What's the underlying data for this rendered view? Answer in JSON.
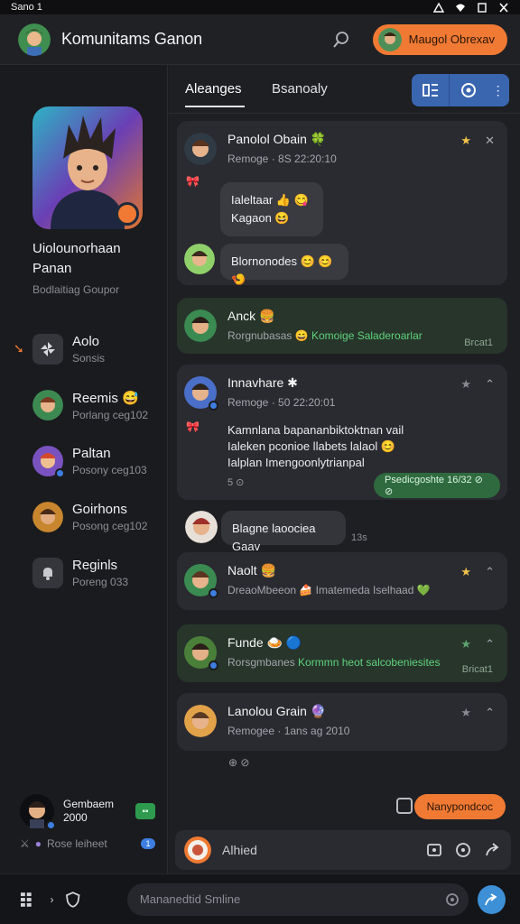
{
  "status_bar": {
    "time": "Sano 1"
  },
  "header": {
    "title": "Komunitams Ganon",
    "profile_label": "Maugol Obrexav"
  },
  "sidebar": {
    "hero_name": "Uiolounorhaan Panan",
    "hero_sub": "Bodlaitiag Goupor",
    "items": [
      {
        "title": "Aolo",
        "sub": "Sonsis",
        "icon": "pinwheel-icon",
        "active": true
      },
      {
        "title": "Reemis 😅",
        "sub": "Porlang ceg102",
        "icon": "avatar"
      },
      {
        "title": "Paltan",
        "sub": "Posony ceg103",
        "icon": "avatar"
      },
      {
        "title": "Goirhons",
        "sub": "Posong ceg102",
        "icon": "avatar"
      },
      {
        "title": "Reginls",
        "sub": "Poreng 033",
        "icon": "bell-icon"
      }
    ],
    "footer": {
      "name": "Gembaem",
      "sub": "2000",
      "badge": "▪▪",
      "status_text": "Rose leiheet",
      "count": "1"
    }
  },
  "tabs": [
    {
      "label": "Aleanges"
    },
    {
      "label": "Bsanoaly"
    }
  ],
  "messages": [
    {
      "name": "Panolol Obain 🍀",
      "meta": "Remoge · 8S 22:20:10",
      "bubble": "Ialeltaar 👍 😋\nKagaon 😆",
      "reply": "Blornonodes 😊 😊 🍤"
    },
    {
      "name": "Anck 🍔",
      "meta_prefix": "Rorgnubasas 😄",
      "meta_highlight": "Komoige Saladeroarlar",
      "time": "Brcat1"
    },
    {
      "name": "Innavhare ✱",
      "meta": "Remoge · 50 22:20:01",
      "lines": [
        "Kamnlana bapananbiktoktnan vail",
        "Ialeken pconioe llabets lalaol 😊",
        "Ialplan Imengoonlytrianpal"
      ],
      "counter": "5 ⊙",
      "pill": "Psedicgoshte 16/32 ⊘ ⊘",
      "reply": "Blagne laoociea Gaav",
      "reply_time": "13s"
    },
    {
      "name": "Naolt 🍔",
      "meta_prefix": "DreaoMbeeon 🍰",
      "meta_rest": "Imatemeda Iselhaad 💚"
    },
    {
      "name": "Funde 🍛 🔵",
      "meta_prefix": "Rorsgmbanes",
      "meta_highlight": "Kormmn heot salcobeniesites",
      "time": "Bricat1"
    },
    {
      "name": "Lanolou Grain 🔮",
      "meta": "Remogee · 1ans ag 2010"
    }
  ],
  "bottom_reactions": "⊕ ⊘",
  "cta_label": "Nanypondcoc",
  "composer": {
    "placeholder": "Alhied"
  },
  "bottom_input": {
    "placeholder": "Mananedtid Smline"
  },
  "colors": {
    "accent_orange": "#f07a33",
    "action_blue": "#3a66b0",
    "green": "#2e9a4e",
    "bg": "#1c1d21"
  }
}
